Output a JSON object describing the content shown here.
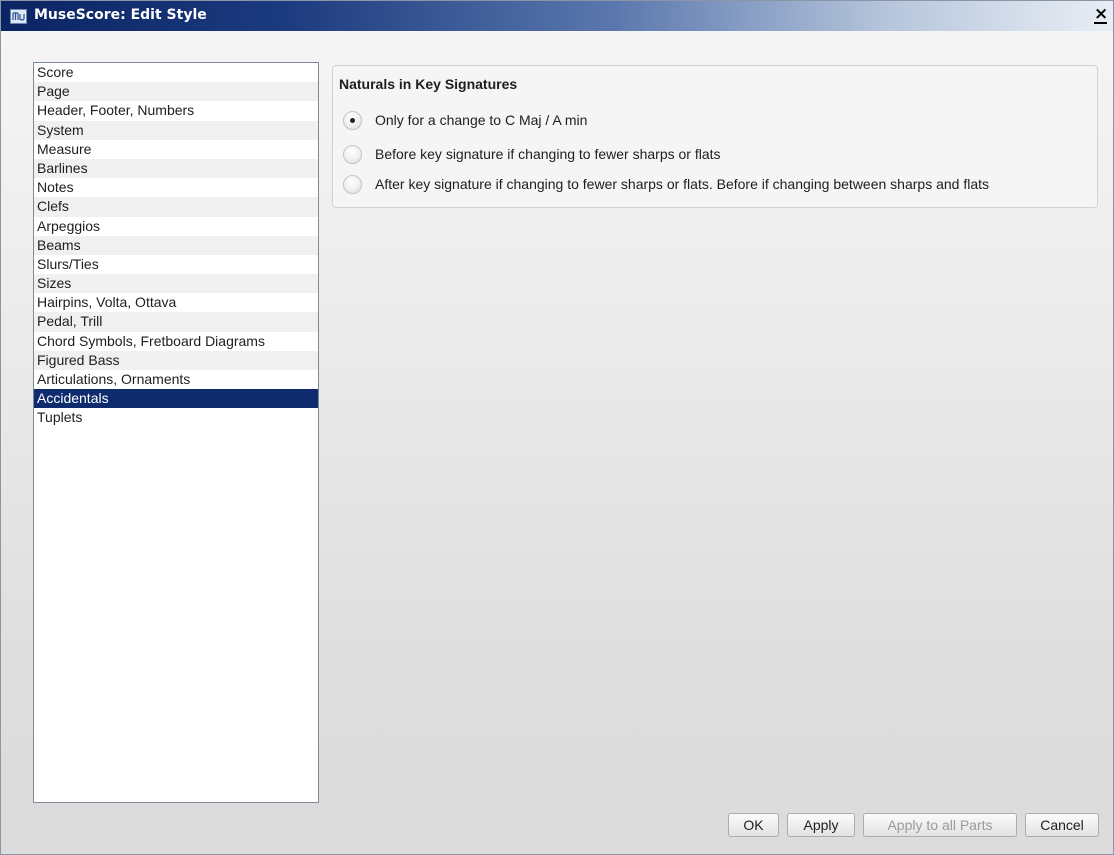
{
  "window": {
    "title": "MuseScore: Edit Style",
    "close_glyph": "×",
    "app_icon": "musescore-app-icon"
  },
  "sidebar": {
    "items": [
      {
        "label": "Score"
      },
      {
        "label": "Page"
      },
      {
        "label": "Header, Footer, Numbers"
      },
      {
        "label": "System"
      },
      {
        "label": "Measure"
      },
      {
        "label": "Barlines"
      },
      {
        "label": "Notes"
      },
      {
        "label": "Clefs"
      },
      {
        "label": "Arpeggios"
      },
      {
        "label": "Beams"
      },
      {
        "label": "Slurs/Ties"
      },
      {
        "label": "Sizes"
      },
      {
        "label": "Hairpins, Volta, Ottava"
      },
      {
        "label": "Pedal, Trill"
      },
      {
        "label": "Chord Symbols, Fretboard Diagrams"
      },
      {
        "label": "Figured Bass"
      },
      {
        "label": "Articulations, Ornaments"
      },
      {
        "label": "Accidentals"
      },
      {
        "label": "Tuplets"
      }
    ],
    "selected_label": "Accidentals"
  },
  "main": {
    "group_title": "Naturals in Key Signatures",
    "options": [
      {
        "label": "Only for a change to C Maj / A min",
        "checked": true
      },
      {
        "label": "Before key signature if changing to fewer sharps or flats",
        "checked": false
      },
      {
        "label": "After key signature if changing to fewer sharps or flats. Before if changing between sharps and flats",
        "checked": false
      }
    ]
  },
  "buttons": {
    "ok": "OK",
    "apply": "Apply",
    "apply_all_parts": "Apply to all Parts",
    "cancel": "Cancel"
  },
  "colors": {
    "selection": "#0e2b6e",
    "title_gradient_start": "#0b2463"
  }
}
